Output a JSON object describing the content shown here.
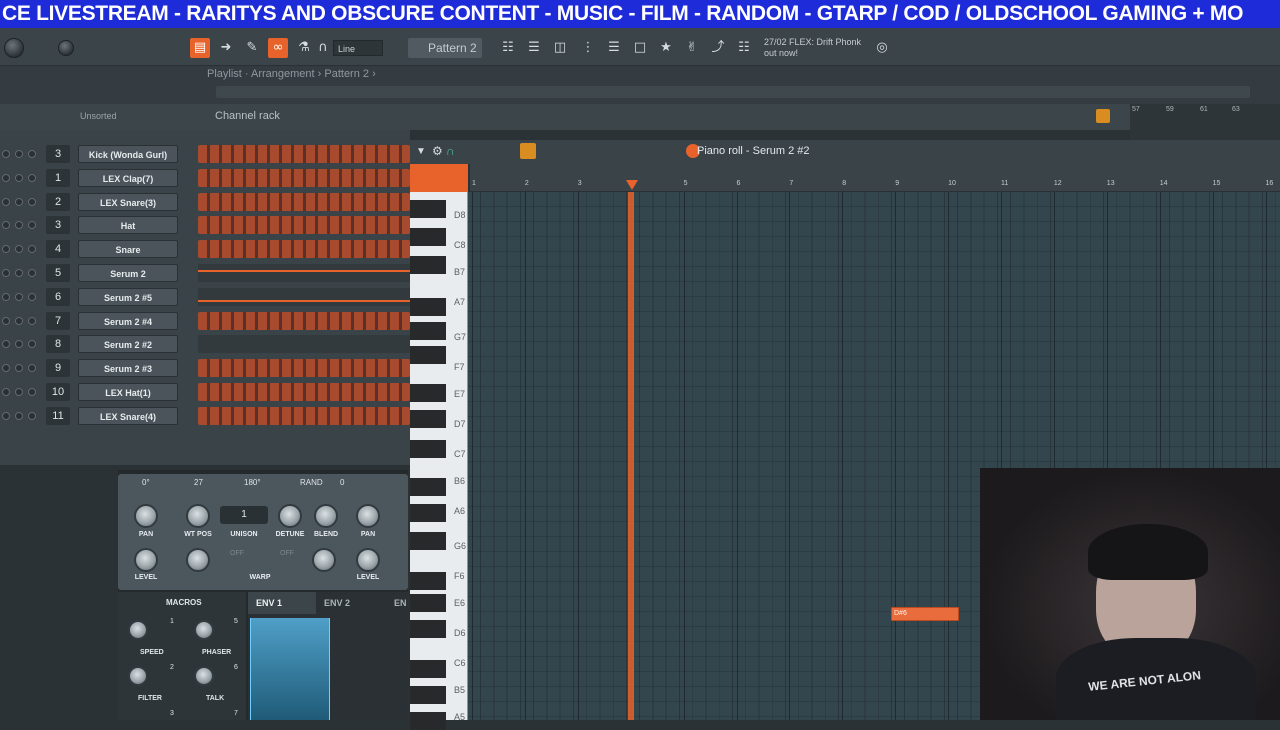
{
  "banner": {
    "text": "CE LIVESTREAM  - RARITYS AND OBSCURE CONTENT - MUSIC - FILM - RANDOM - GTARP / COD / OLDSCHOOL GAMING + MO"
  },
  "toolbar": {
    "snap_mode": "Line",
    "pattern": "Pattern 2",
    "news": "27/02  FLEX: Drift Phonk out now!"
  },
  "playlist": {
    "title": "Playlist · Arrangement › Pattern 2 ›"
  },
  "channel_rack": {
    "filter": "Unsorted",
    "title": "Channel rack",
    "channels": [
      {
        "num": "3",
        "name": "Kick (Wonda Gurl)"
      },
      {
        "num": "1",
        "name": "LEX Clap(7)"
      },
      {
        "num": "2",
        "name": "LEX Snare(3)"
      },
      {
        "num": "3",
        "name": "Hat"
      },
      {
        "num": "4",
        "name": "Snare"
      },
      {
        "num": "5",
        "name": "Serum 2"
      },
      {
        "num": "6",
        "name": "Serum 2 #5"
      },
      {
        "num": "7",
        "name": "Serum 2 #4"
      },
      {
        "num": "8",
        "name": "Serum 2 #2"
      },
      {
        "num": "9",
        "name": "Serum 2 #3"
      },
      {
        "num": "10",
        "name": "LEX Hat(1)"
      },
      {
        "num": "11",
        "name": "LEX Snare(4)"
      }
    ]
  },
  "serum": {
    "phase": "0°",
    "wt_pos": "27",
    "phase2": "180°",
    "rand": "RAND",
    "rand_val": "0",
    "unison": "1",
    "knob_labels": [
      "PAN",
      "WT POS",
      "UNISON",
      "DETUNE",
      "BLEND",
      "PAN",
      "LEVEL",
      "WARP",
      "LEVEL"
    ],
    "warp_off1": "OFF",
    "warp_off2": "OFF",
    "macros_title": "MACROS",
    "env1": "ENV 1",
    "env2": "ENV 2",
    "env3": "EN",
    "macros": [
      {
        "num": "1",
        "label": "SPEED"
      },
      {
        "num": "5",
        "label": "PHASER"
      },
      {
        "num": "2",
        "label": "FILTER"
      },
      {
        "num": "6",
        "label": "TALK"
      },
      {
        "num": "3",
        "label": ""
      },
      {
        "num": "7",
        "label": ""
      }
    ]
  },
  "piano_roll": {
    "title": "Piano roll - Serum 2 #2",
    "ruler": [
      "1",
      "2",
      "3",
      "4",
      "5",
      "6",
      "7",
      "8",
      "9",
      "10",
      "11",
      "12",
      "13",
      "14",
      "15",
      "16"
    ],
    "playlist_ruler": [
      "57",
      "59",
      "61",
      "63"
    ],
    "key_labels": [
      "D8",
      "C8",
      "B7",
      "A7",
      "G7",
      "F7",
      "E7",
      "D7",
      "C7",
      "B6",
      "A6",
      "G6",
      "F6",
      "E6",
      "D6",
      "C6",
      "B5",
      "A5"
    ],
    "note_label": "D#6"
  },
  "webcam": {
    "shirt_text": "WE ARE NOT ALON"
  },
  "colors": {
    "accent": "#e8632b",
    "banner": "#1d2bd8",
    "grid": "#34464d"
  }
}
